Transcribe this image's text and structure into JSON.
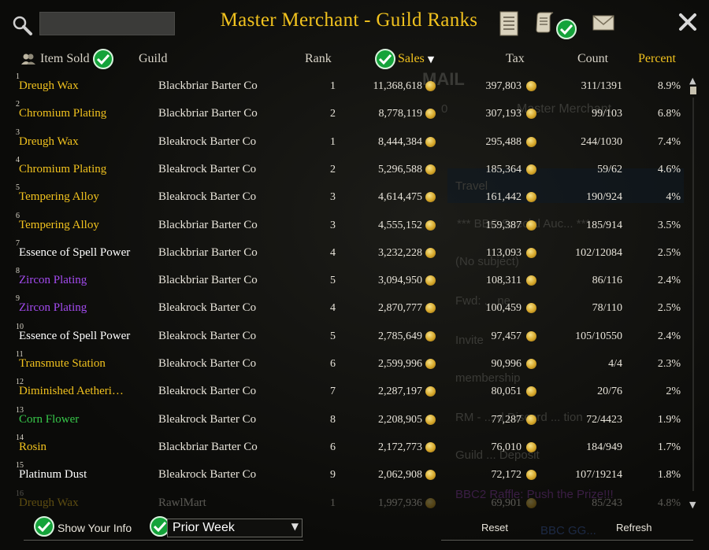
{
  "title": "Master Merchant - Guild Ranks",
  "search": {
    "value": "",
    "placeholder": ""
  },
  "header": {
    "item_sold": "Item Sold",
    "guild": "Guild",
    "rank": "Rank",
    "sales": "Sales",
    "sales_sort_indicator": "▼",
    "tax": "Tax",
    "count": "Count",
    "percent": "Percent"
  },
  "rows": [
    {
      "num": "1",
      "item": "Dreugh Wax",
      "item_color": "#f1c21e",
      "guild": "Blackbriar Barter Co",
      "rank": "1",
      "sales": "11,368,618",
      "tax": "397,803",
      "count": "311/1391",
      "percent": "8.9%"
    },
    {
      "num": "2",
      "item": "Chromium Plating",
      "item_color": "#f1c21e",
      "guild": "Blackbriar Barter Co",
      "rank": "2",
      "sales": "8,778,119",
      "tax": "307,193",
      "count": "99/103",
      "percent": "6.8%"
    },
    {
      "num": "3",
      "item": "Dreugh Wax",
      "item_color": "#f1c21e",
      "guild": "Bleakrock Barter Co",
      "rank": "1",
      "sales": "8,444,384",
      "tax": "295,488",
      "count": "244/1030",
      "percent": "7.4%"
    },
    {
      "num": "4",
      "item": "Chromium Plating",
      "item_color": "#f1c21e",
      "guild": "Bleakrock Barter Co",
      "rank": "2",
      "sales": "5,296,588",
      "tax": "185,364",
      "count": "59/62",
      "percent": "4.6%"
    },
    {
      "num": "5",
      "item": "Tempering Alloy",
      "item_color": "#f1c21e",
      "guild": "Bleakrock Barter Co",
      "rank": "3",
      "sales": "4,614,475",
      "tax": "161,442",
      "count": "190/924",
      "percent": "4%"
    },
    {
      "num": "6",
      "item": "Tempering Alloy",
      "item_color": "#f1c21e",
      "guild": "Blackbriar Barter Co",
      "rank": "3",
      "sales": "4,555,152",
      "tax": "159,387",
      "count": "185/914",
      "percent": "3.5%"
    },
    {
      "num": "7",
      "item": "Essence of Spell Power",
      "item_color": "#ffffff",
      "guild": "Blackbriar Barter Co",
      "rank": "4",
      "sales": "3,232,228",
      "tax": "113,093",
      "count": "102/12084",
      "percent": "2.5%"
    },
    {
      "num": "8",
      "item": "Zircon Plating",
      "item_color": "#a44bf0",
      "guild": "Blackbriar Barter Co",
      "rank": "5",
      "sales": "3,094,950",
      "tax": "108,311",
      "count": "86/116",
      "percent": "2.4%"
    },
    {
      "num": "9",
      "item": "Zircon Plating",
      "item_color": "#a44bf0",
      "guild": "Bleakrock Barter Co",
      "rank": "4",
      "sales": "2,870,777",
      "tax": "100,459",
      "count": "78/110",
      "percent": "2.5%"
    },
    {
      "num": "10",
      "item": "Essence of Spell Power",
      "item_color": "#ffffff",
      "guild": "Bleakrock Barter Co",
      "rank": "5",
      "sales": "2,785,649",
      "tax": "97,457",
      "count": "105/10550",
      "percent": "2.4%"
    },
    {
      "num": "11",
      "item": "Transmute Station",
      "item_color": "#f1c21e",
      "guild": "Bleakrock Barter Co",
      "rank": "6",
      "sales": "2,599,996",
      "tax": "90,996",
      "count": "4/4",
      "percent": "2.3%"
    },
    {
      "num": "12",
      "item": "Diminished Aetheri…",
      "item_color": "#f1c21e",
      "guild": "Bleakrock Barter Co",
      "rank": "7",
      "sales": "2,287,197",
      "tax": "80,051",
      "count": "20/76",
      "percent": "2%"
    },
    {
      "num": "13",
      "item": "Corn Flower",
      "item_color": "#37c84a",
      "guild": "Bleakrock Barter Co",
      "rank": "8",
      "sales": "2,208,905",
      "tax": "77,287",
      "count": "72/4423",
      "percent": "1.9%"
    },
    {
      "num": "14",
      "item": "Rosin",
      "item_color": "#f1c21e",
      "guild": "Blackbriar Barter Co",
      "rank": "6",
      "sales": "2,172,773",
      "tax": "76,010",
      "count": "184/949",
      "percent": "1.7%"
    },
    {
      "num": "15",
      "item": "Platinum Dust",
      "item_color": "#ffffff",
      "guild": "Bleakrock Barter Co",
      "rank": "9",
      "sales": "2,062,908",
      "tax": "72,172",
      "count": "107/19214",
      "percent": "1.8%"
    },
    {
      "num": "16",
      "item": "Dreugh Wax",
      "item_color": "#f1c21e",
      "guild": "RawlMart",
      "rank": "1",
      "sales": "1,997,936",
      "tax": "69,901",
      "count": "85/243",
      "percent": "4.8%"
    }
  ],
  "footer": {
    "show_your_info": "Show Your Info",
    "period": "Prior Week",
    "reset": "Reset",
    "refresh": "Refresh"
  },
  "background": {
    "mail": "MAIL",
    "mail_count": "0",
    "sender": "Master Merchant",
    "lines": [
      "Travel",
      "*** BBC Special Auc... ***",
      "(No subject)",
      "Fwd: ... ne",
      "Invite",
      "membership",
      "RM - ... d Discord ... tion",
      "Guild ... Deposit",
      "BBC2 Raffle: Push the Prize!!!",
      "BBC GG..."
    ]
  },
  "icons": {
    "search": "search-icon",
    "ledger": "ledger-icon",
    "scroll": "scroll-icon",
    "mail": "mail-icon",
    "close": "close-icon",
    "check": "check-icon",
    "guild_people": "people-icon",
    "gold": "gold-coin-icon"
  },
  "colors": {
    "title_gold": "#f1c21e",
    "check_green": "#14a33a",
    "rare_purple": "#a44bf0",
    "fine_green": "#37c84a"
  }
}
